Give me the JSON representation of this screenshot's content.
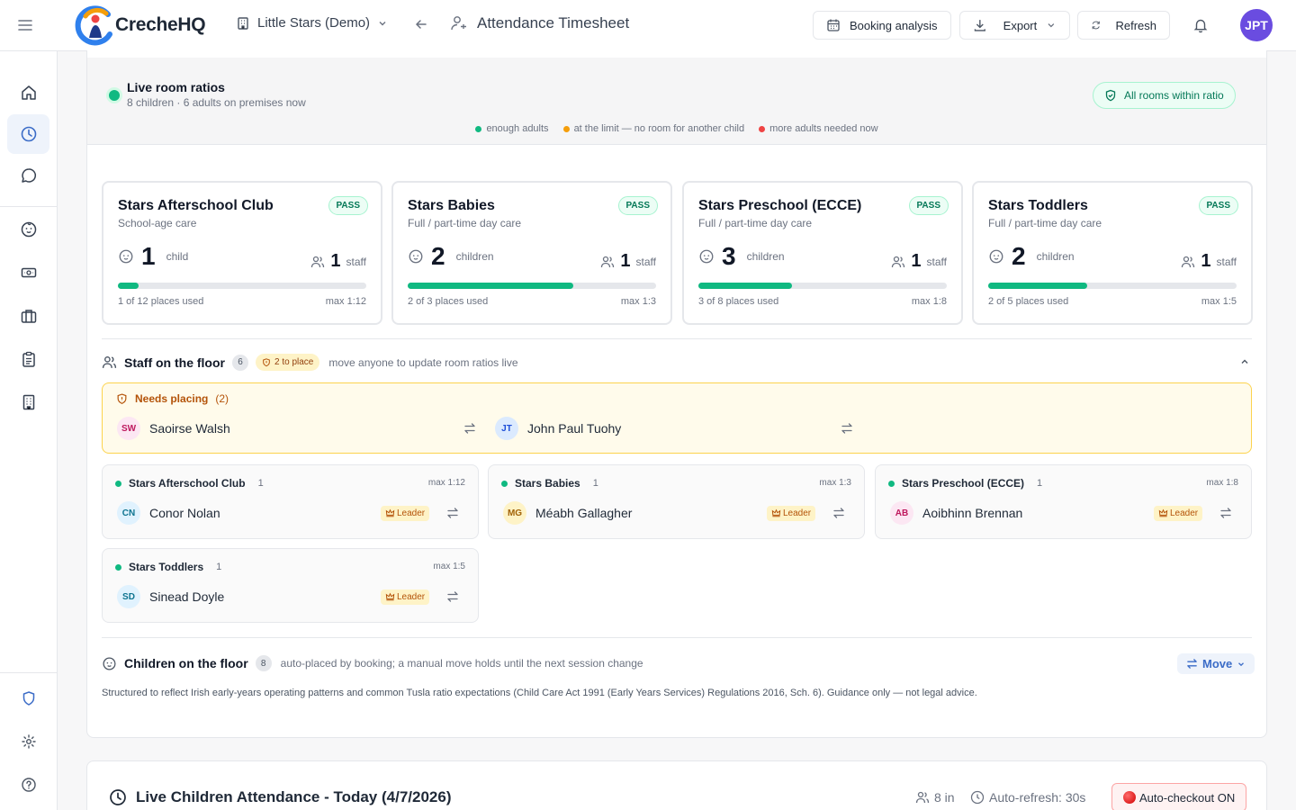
{
  "app": {
    "brand": "CrecheHQ",
    "org": "Little Stars (Demo)",
    "page_title": "Attendance Timesheet",
    "user_initials": "JPT"
  },
  "toolbar": {
    "booking_analysis": "Booking analysis",
    "export": "Export",
    "refresh": "Refresh"
  },
  "ratios": {
    "title": "Live room ratios",
    "subtitle": "8 children · 6 adults on premises now",
    "status": "All rooms within ratio",
    "legend": [
      {
        "label": "enough adults",
        "color": "#10b981"
      },
      {
        "label": "at the limit — no room for another child",
        "color": "#f59e0b"
      },
      {
        "label": "more adults needed now",
        "color": "#ef4444"
      }
    ],
    "rooms": [
      {
        "name": "Stars Afterschool Club",
        "sub": "School-age care",
        "badge": "PASS",
        "children": "1",
        "children_label": "child",
        "staff": "1",
        "staff_label": "staff",
        "fill": 0.0833,
        "used": "1 of 12 places used",
        "max": "max 1:12"
      },
      {
        "name": "Stars Babies",
        "sub": "Full / part-time day care",
        "badge": "PASS",
        "children": "2",
        "children_label": "children",
        "staff": "1",
        "staff_label": "staff",
        "fill": 0.6667,
        "used": "2 of 3 places used",
        "max": "max 1:3"
      },
      {
        "name": "Stars Preschool (ECCE)",
        "sub": "Full / part-time day care",
        "badge": "PASS",
        "children": "3",
        "children_label": "children",
        "staff": "1",
        "staff_label": "staff",
        "fill": 0.375,
        "used": "3 of 8 places used",
        "max": "max 1:8"
      },
      {
        "name": "Stars Toddlers",
        "sub": "Full / part-time day care",
        "badge": "PASS",
        "children": "2",
        "children_label": "children",
        "staff": "1",
        "staff_label": "staff",
        "fill": 0.4,
        "used": "2 of 5 places used",
        "max": "max 1:5"
      }
    ]
  },
  "staff_floor": {
    "title": "Staff on the floor",
    "count": "6",
    "to_place": "2 to place",
    "hint": "move anyone to update room ratios live",
    "needs_placing": {
      "title": "Needs placing",
      "count": "(2)",
      "people": [
        {
          "initials": "SW",
          "name": "Saoirse Walsh"
        },
        {
          "initials": "JT",
          "name": "John Paul Tuohy"
        }
      ]
    },
    "rooms": [
      {
        "name": "Stars Afterschool Club",
        "count": "1",
        "max": "max 1:12",
        "initials": "CN",
        "person": "Conor Nolan",
        "badge": "Leader"
      },
      {
        "name": "Stars Babies",
        "count": "1",
        "max": "max 1:3",
        "initials": "MG",
        "person": "Méabh Gallagher",
        "badge": "Leader"
      },
      {
        "name": "Stars Preschool (ECCE)",
        "count": "1",
        "max": "max 1:8",
        "initials": "AB",
        "person": "Aoibhinn Brennan",
        "badge": "Leader"
      },
      {
        "name": "Stars Toddlers",
        "count": "1",
        "max": "max 1:5",
        "initials": "SD",
        "person": "Sinead Doyle",
        "badge": "Leader"
      }
    ]
  },
  "children_floor": {
    "title": "Children on the floor",
    "count": "8",
    "hint": "auto-placed by booking; a manual move holds until the next session change",
    "move": "Move",
    "note": "Structured to reflect Irish early-years operating patterns and common Tusla ratio expectations (Child Care Act 1991 (Early Years Services) Regulations 2016, Sch. 6). Guidance only — not legal advice."
  },
  "attendance": {
    "title": "Live Children Attendance - Today (4/7/2026)",
    "in_count": "8 in",
    "auto_refresh": "Auto-refresh: 30s",
    "auto_checkout": "Auto-checkout ON"
  }
}
